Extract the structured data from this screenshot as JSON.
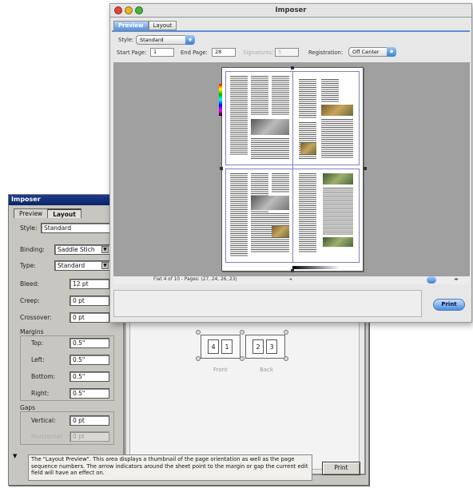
{
  "back_window": {
    "title": "Imposer",
    "tabs": [
      "Preview",
      "Layout"
    ],
    "style_label": "Style:",
    "style_value": "Standard",
    "binding_label": "Binding:",
    "binding_value": "Saddle Stich",
    "type_label": "Type:",
    "type_value": "Standard",
    "bleed_label": "Bleed:",
    "bleed_value": "12 pt",
    "creep_label": "Creep:",
    "creep_value": "0 pt",
    "crossover_label": "Crossover:",
    "crossover_value": "0 pt",
    "margins_label": "Margins",
    "top_label": "Top:",
    "top_value": "0.5\"",
    "left_label": "Left:",
    "left_value": "0.5\"",
    "bottom_label": "Bottom:",
    "bottom_value": "0.5\"",
    "right_label": "Right:",
    "right_value": "0.5\"",
    "gaps_label": "Gaps",
    "vertical_label": "Vertical:",
    "vertical_value": "0 pt",
    "horizontal_label": "Horizontal:",
    "horizontal_value": "0 pt",
    "front_label": "Front",
    "back_label": "Back",
    "thumb_pages": [
      "4",
      "1",
      "2",
      "3"
    ],
    "help_text": "The \"Layout Preview\". This area displays a thumbnail of the page orientation as well as the page sequence numbers. The arrow indicators around the sheet point to the margin or gap the current edit field will have an effect on.",
    "print_label": "Print"
  },
  "front_window": {
    "title": "Imposer",
    "tabs": [
      "Preview",
      "Layout"
    ],
    "style_label": "Style:",
    "style_value": "Standard",
    "start_page_label": "Start Page:",
    "start_page_value": "1",
    "end_page_label": "End Page:",
    "end_page_value": "28",
    "signatures_label": "Signatures:",
    "signatures_value": "5",
    "registration_label": "Registration:",
    "registration_value": "Off Center",
    "status_text": "Flat 4 of 10 - Pages: (27, 24, 26, 23)",
    "print_label": "Print"
  }
}
